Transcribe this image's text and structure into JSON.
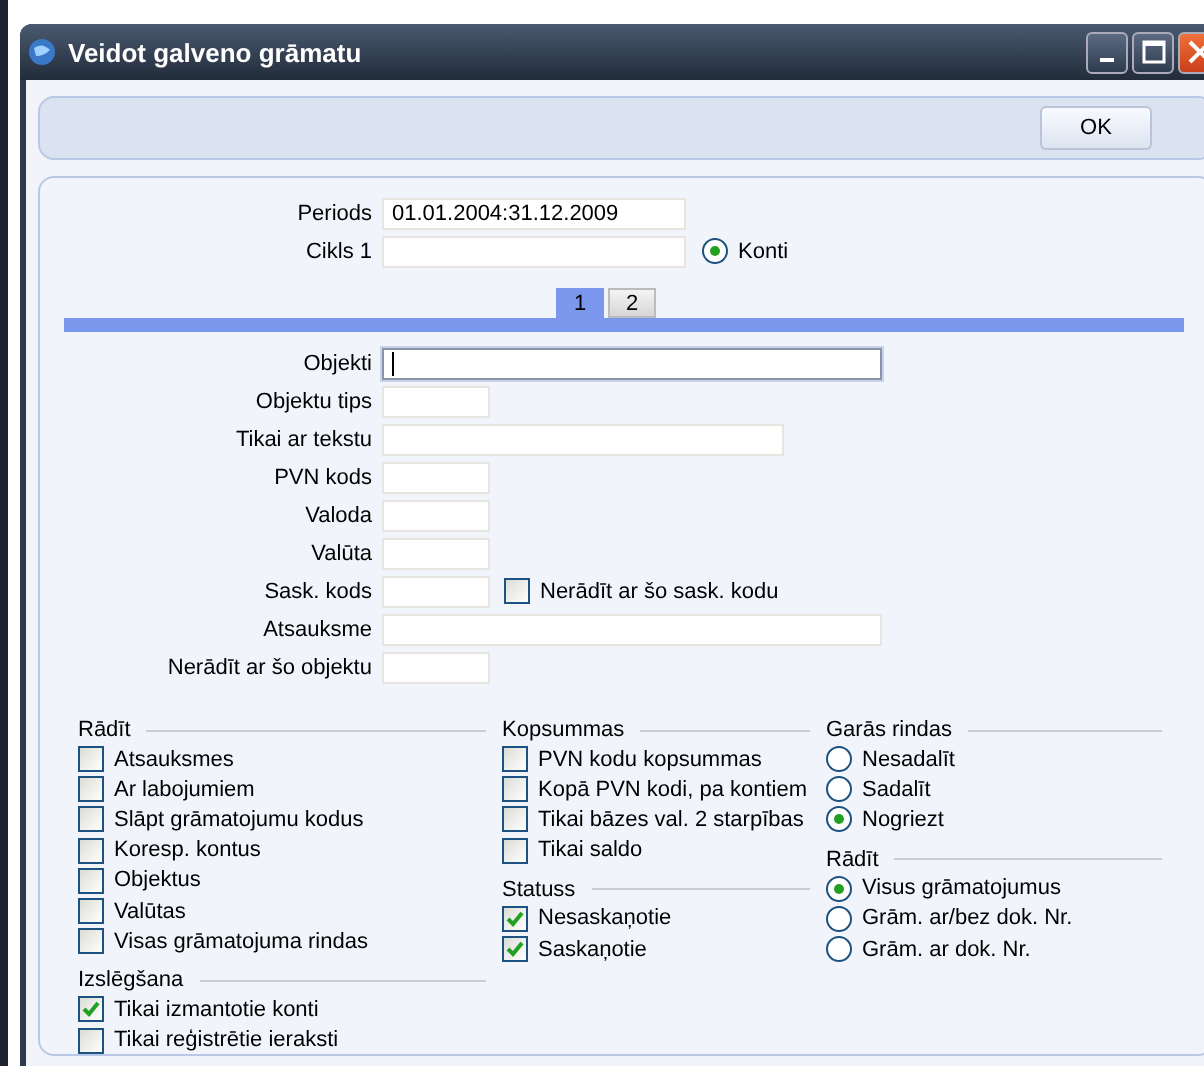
{
  "window": {
    "title": "Veidot galveno grāmatu"
  },
  "toolbar": {
    "ok_button": "OK"
  },
  "header": {
    "periods": {
      "label": "Periods",
      "value": "01.01.2004:31.12.2009"
    },
    "cikls": {
      "label": "Cikls 1"
    },
    "konti": {
      "label": "Konti",
      "selected": true
    }
  },
  "tabs": [
    {
      "label": "1",
      "selected": true
    },
    {
      "label": "2",
      "selected": false
    }
  ],
  "fields": [
    {
      "label": "Objekti",
      "focused": true
    },
    {
      "label": "Objektu tips",
      "focused": false
    },
    {
      "label": "Tikai ar tekstu",
      "focused": false
    },
    {
      "label": "PVN kods",
      "focused": false
    },
    {
      "label": "Valoda",
      "focused": false
    },
    {
      "label": "Valūta",
      "focused": false
    },
    {
      "label": "Sask. kods",
      "focused": false,
      "checkbox": {
        "label": "Nerādīt ar šo sask. kodu",
        "checked": false
      }
    },
    {
      "label": "Atsauksme",
      "focused": false
    },
    {
      "label": "Nerādīt ar šo objektu",
      "focused": false
    }
  ],
  "columns": [
    [
      {
        "title": "Rādīt",
        "kind": "checkbox",
        "items": [
          {
            "label": "Atsauksmes",
            "checked": false
          },
          {
            "label": "Ar labojumiem",
            "checked": false
          },
          {
            "label": "Slāpt grāmatojumu kodus",
            "checked": false
          },
          {
            "label": "Koresp. kontus",
            "checked": false
          },
          {
            "label": "Objektus",
            "checked": false
          },
          {
            "label": "Valūtas",
            "checked": false
          },
          {
            "label": "Visas grāmatojuma rindas",
            "checked": false
          }
        ]
      },
      {
        "title": "Izslēgšana",
        "kind": "checkbox",
        "items": [
          {
            "label": "Tikai izmantotie konti",
            "checked": true
          },
          {
            "label": "Tikai reģistrētie ieraksti",
            "checked": false
          }
        ]
      }
    ],
    [
      {
        "title": "Kopsummas",
        "kind": "checkbox",
        "items": [
          {
            "label": "PVN kodu kopsummas",
            "checked": false
          },
          {
            "label": "Kopā PVN kodi, pa kontiem",
            "checked": false
          },
          {
            "label": "Tikai bāzes val. 2 starpības",
            "checked": false
          },
          {
            "label": "Tikai saldo",
            "checked": false
          }
        ]
      },
      {
        "title": "Statuss",
        "kind": "checkbox",
        "items": [
          {
            "label": "Nesaskaņotie",
            "checked": true
          },
          {
            "label": "Saskaņotie",
            "checked": true
          }
        ]
      }
    ],
    [
      {
        "title": "Garās rindas",
        "kind": "radio",
        "items": [
          {
            "label": "Nesadalīt",
            "selected": false
          },
          {
            "label": "Sadalīt",
            "selected": false
          },
          {
            "label": "Nogriezt",
            "selected": true
          }
        ]
      },
      {
        "title": "Rādīt",
        "kind": "radio",
        "items": [
          {
            "label": "Visus grāmatojumus",
            "selected": true
          },
          {
            "label": "Grām. ar/bez dok. Nr.",
            "selected": false
          },
          {
            "label": "Grām. ar dok. Nr.",
            "selected": false
          }
        ]
      }
    ]
  ]
}
